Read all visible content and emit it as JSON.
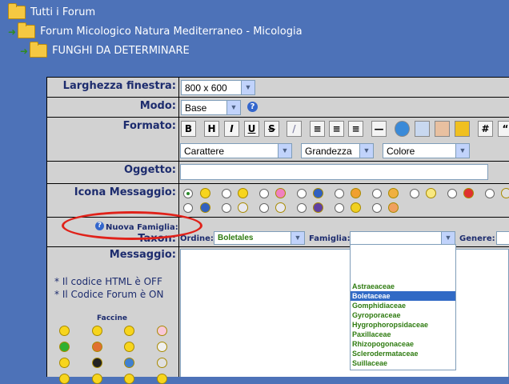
{
  "breadcrumb": [
    {
      "label": "Tutti i Forum"
    },
    {
      "label": "Forum Micologico Natura Mediterraneo - Micologia"
    },
    {
      "label": "FUNGHI DA DETERMINARE"
    }
  ],
  "form": {
    "larghezza_label": "Larghezza finestra:",
    "larghezza_value": "800 x 600",
    "modo_label": "Modo:",
    "modo_value": "Base",
    "help_glyph": "?",
    "formato_label": "Formato:",
    "format_buttons": [
      "B",
      "H",
      "I",
      "U",
      "S"
    ],
    "carattere": "Carattere",
    "grandezza": "Grandezza",
    "colore": "Colore",
    "oggetto_label": "Oggetto:",
    "icona_label": "Icona Messaggio:",
    "nuova_famiglia": "Nuova Famiglia:",
    "taxon_label": "Taxon:",
    "ordine_label": "Ordine:",
    "ordine_value": "Boletales",
    "famiglia_label": "Famiglia:",
    "genere_label": "Genere:",
    "messaggio_label": "Messaggio:",
    "html_note": "* Il codice HTML è OFF",
    "forum_note": "* Il Codice Forum è ON",
    "faccine_label": "Faccine"
  },
  "famiglia_options": [
    "Astraeaceae",
    "Boletaceae",
    "Gomphidiaceae",
    "Gyroporaceae",
    "Hygrophoropsidaceae",
    "Paxillaceae",
    "Rhizopogonaceae",
    "Sclerodermataceae",
    "Suillaceae"
  ],
  "famiglia_selected": "Boletaceae",
  "colors": {
    "background": "#4d72b8",
    "label": "#1d2c6e",
    "highlight": "#e0221a",
    "option": "#2e7b10",
    "selection": "#316ac5"
  }
}
